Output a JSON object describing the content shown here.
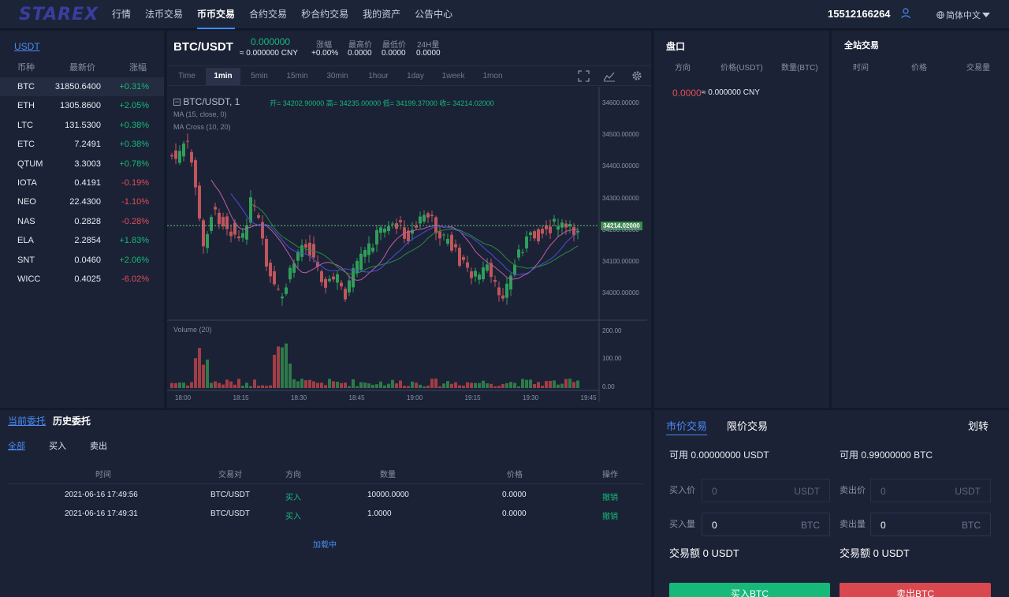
{
  "brand": "STAREX",
  "nav": [
    "行情",
    "法币交易",
    "币币交易",
    "合约交易",
    "秒合约交易",
    "我的资产",
    "公告中心"
  ],
  "user": {
    "phone": "15512166264",
    "language": "简体中文"
  },
  "market": {
    "tab": "USDT",
    "headers": [
      "币种",
      "最新价",
      "涨幅"
    ],
    "rows": [
      {
        "coin": "BTC",
        "price": "31850.6400",
        "change": "+0.31%",
        "up": true
      },
      {
        "coin": "ETH",
        "price": "1305.8600",
        "change": "+2.05%",
        "up": true
      },
      {
        "coin": "LTC",
        "price": "131.5300",
        "change": "+0.38%",
        "up": true
      },
      {
        "coin": "ETC",
        "price": "7.2491",
        "change": "+0.38%",
        "up": true
      },
      {
        "coin": "QTUM",
        "price": "3.3003",
        "change": "+0.78%",
        "up": true
      },
      {
        "coin": "IOTA",
        "price": "0.4191",
        "change": "-0.19%",
        "up": false
      },
      {
        "coin": "NEO",
        "price": "22.4300",
        "change": "-1.10%",
        "up": false
      },
      {
        "coin": "NAS",
        "price": "0.2828",
        "change": "-0.28%",
        "up": false
      },
      {
        "coin": "ELA",
        "price": "2.2854",
        "change": "+1.83%",
        "up": true
      },
      {
        "coin": "SNT",
        "price": "0.0460",
        "change": "+2.06%",
        "up": true
      },
      {
        "coin": "WICC",
        "price": "0.4025",
        "change": "-6.02%",
        "up": false
      }
    ]
  },
  "ticker": {
    "pair": "BTC/USDT",
    "price": "0.000000",
    "cny": "≈ 0.000000 CNY",
    "change_label": "涨幅",
    "change": "+0.00%",
    "high_label": "最高价",
    "high": "0.0000",
    "low_label": "最低价",
    "low": "0.0000",
    "vol_label": "24H量",
    "vol": "0.0000"
  },
  "timeframes": [
    "Time",
    "1min",
    "5min",
    "15min",
    "30min",
    "1hour",
    "1day",
    "1week",
    "1mon"
  ],
  "chart": {
    "symbol": "BTC/USDT, 1",
    "ohlc": "开= 34202.90000  高= 34235.00000  低= 34199.37000  收= 34214.02000",
    "ma": "MA (15, close, 0)",
    "macross": "MA Cross (10, 20)",
    "volume": "Volume (20)",
    "last_price": "34214.02000",
    "price_ticks": [
      "34600.00000",
      "34500.00000",
      "34400.00000",
      "34300.00000",
      "34200.00000",
      "34100.00000",
      "34000.00000"
    ],
    "vol_ticks": [
      "200.00",
      "100.00",
      "0.00"
    ],
    "time_ticks": [
      "18:00",
      "18:15",
      "18:30",
      "18:45",
      "19:00",
      "19:15",
      "19:30",
      "19:45"
    ]
  },
  "orderbook": {
    "title": "盘口",
    "headers": [
      "方向",
      "价格(USDT)",
      "数量(BTC)"
    ],
    "price": "0.0000",
    "cny": "≈ 0.000000 CNY"
  },
  "trades": {
    "title": "全站交易",
    "headers": [
      "时间",
      "价格",
      "交易量"
    ]
  },
  "orders": {
    "tabs": [
      "当前委托",
      "历史委托"
    ],
    "filters": [
      "全部",
      "买入",
      "卖出"
    ],
    "headers": [
      "时间",
      "交易对",
      "方向",
      "数量",
      "价格",
      "操作"
    ],
    "rows": [
      {
        "time": "2021-06-16 17:49:56",
        "pair": "BTC/USDT",
        "side": "买入",
        "qty": "10000.0000",
        "price": "0.0000",
        "action": "撤销"
      },
      {
        "time": "2021-06-16 17:49:31",
        "pair": "BTC/USDT",
        "side": "买入",
        "qty": "1.0000",
        "price": "0.0000",
        "action": "撤销"
      }
    ],
    "loading": "加载中"
  },
  "trade_form": {
    "tabs": [
      "市价交易",
      "限价交易"
    ],
    "transfer": "划转",
    "buy_avail": "可用 0.00000000 USDT",
    "sell_avail": "可用 0.99000000 BTC",
    "buy_price_label": "买入价",
    "buy_price_placeholder": "0",
    "buy_price_unit": "USDT",
    "buy_qty_label": "买入量",
    "buy_qty": "0",
    "buy_qty_unit": "BTC",
    "sell_price_label": "卖出价",
    "sell_price_placeholder": "0",
    "sell_price_unit": "USDT",
    "sell_qty_label": "卖出量",
    "sell_qty": "0",
    "sell_qty_unit": "BTC",
    "buy_amount": "交易额 0 USDT",
    "sell_amount": "交易额 0 USDT",
    "buy_button": "买入BTC",
    "sell_button": "卖出BTC"
  },
  "colors": {
    "up": "#16b979",
    "down": "#e04e58",
    "accent": "#3b8cff"
  }
}
